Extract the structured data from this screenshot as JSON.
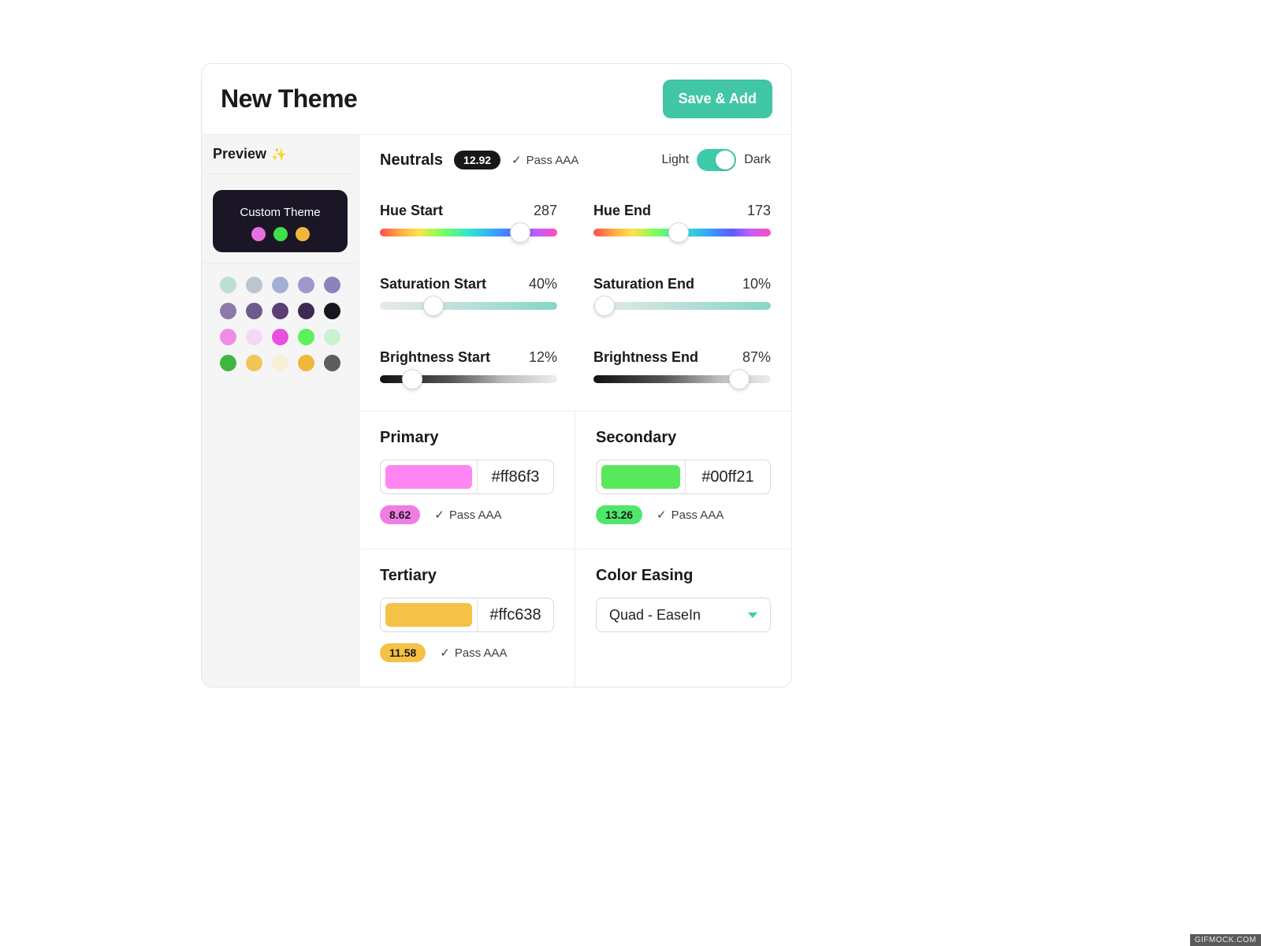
{
  "header": {
    "title": "New Theme",
    "save_label": "Save & Add"
  },
  "preview": {
    "label": "Preview",
    "sparkle": "✨",
    "card_title": "Custom Theme",
    "dot_colors": [
      "#e86fe0",
      "#3fe04a",
      "#f0b83b"
    ],
    "swatches": [
      "#bcded5",
      "#bac5cf",
      "#a3aed4",
      "#9d99c9",
      "#8e82bb",
      "#8d7aa9",
      "#6d5b8e",
      "#5a3f74",
      "#3d2a52",
      "#18151c",
      "#f08be6",
      "#f6d7f2",
      "#e94fe1",
      "#5cf25c",
      "#c9f2d0",
      "#3fb73f",
      "#f1c557",
      "#f8efd6",
      "#f0b83b",
      "#5d5d5d"
    ]
  },
  "neutrals": {
    "title": "Neutrals",
    "contrast": "12.92",
    "pass_label": "Pass AAA",
    "mode": {
      "light_label": "Light",
      "dark_label": "Dark"
    },
    "sliders": {
      "hue_start": {
        "label": "Hue Start",
        "value": "287",
        "pct": 79
      },
      "hue_end": {
        "label": "Hue End",
        "value": "173",
        "pct": 48
      },
      "saturation_start": {
        "label": "Saturation Start",
        "value": "40%",
        "pct": 30
      },
      "saturation_end": {
        "label": "Saturation End",
        "value": "10%",
        "pct": 6
      },
      "brightness_start": {
        "label": "Brightness Start",
        "value": "12%",
        "pct": 18
      },
      "brightness_end": {
        "label": "Brightness End",
        "value": "87%",
        "pct": 82
      }
    }
  },
  "primary": {
    "title": "Primary",
    "color": "#ff86f3",
    "hex": "#ff86f3",
    "contrast": "8.62",
    "pass_label": "Pass AAA"
  },
  "secondary": {
    "title": "Secondary",
    "color": "#58e85b",
    "hex": "#00ff21",
    "contrast": "13.26",
    "pass_label": "Pass AAA"
  },
  "tertiary": {
    "title": "Tertiary",
    "color": "#f5c146",
    "hex": "#ffc638",
    "contrast": "11.58",
    "pass_label": "Pass AAA"
  },
  "easing": {
    "title": "Color Easing",
    "selected": "Quad - EaseIn"
  },
  "watermark": "GIFMOCK.COM"
}
